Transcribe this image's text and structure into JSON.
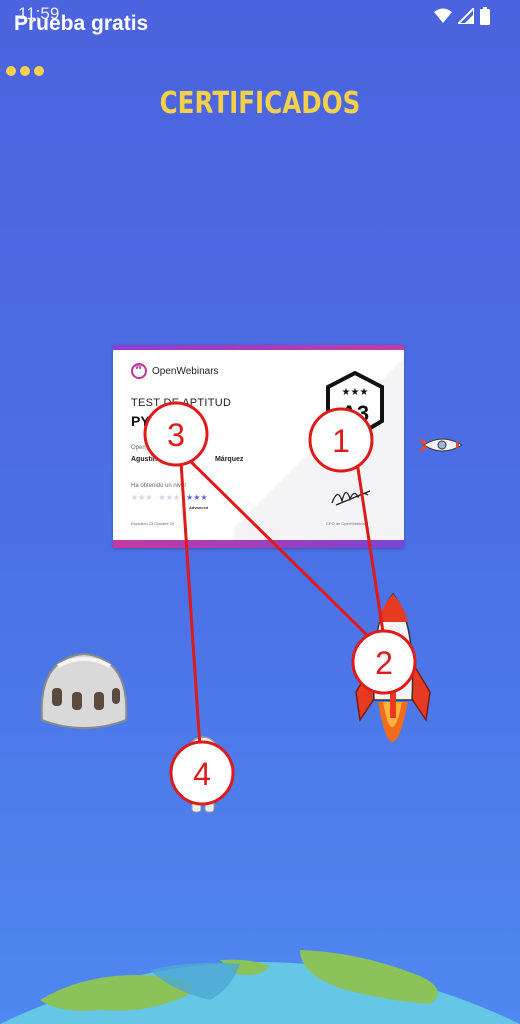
{
  "status_bar": {
    "time": "11:59"
  },
  "trial": {
    "label": "Prueba gratis"
  },
  "page": {
    "title": "CERTIFICADOS"
  },
  "certificate": {
    "brand": "OpenWebinars",
    "heading": "TEST DE APTITUD",
    "subject": "PY",
    "obtained_text": "Open",
    "recipient": "Agustin",
    "recipient_suffix": "Márquez",
    "level_text": "Ha obtenido un nivel",
    "levels": [
      "",
      "",
      "Advanced"
    ],
    "badge_code": "A3",
    "date_text": "Expedido 23 Octubre 20",
    "signer": "CEO de OpenWebinars"
  },
  "annotations": [
    {
      "label": "1"
    },
    {
      "label": "2"
    },
    {
      "label": "3"
    },
    {
      "label": "4"
    }
  ],
  "colors": {
    "background": "#4b6ae2",
    "title": "#f4cf48",
    "accent": "#c2349a",
    "annotation": "#e01919"
  },
  "icons": [
    "wifi-icon",
    "signal-icon",
    "battery-icon",
    "rocket-icon",
    "small-rocket-icon",
    "space-helmet-icon",
    "astronaut-icon",
    "planet-icon"
  ]
}
